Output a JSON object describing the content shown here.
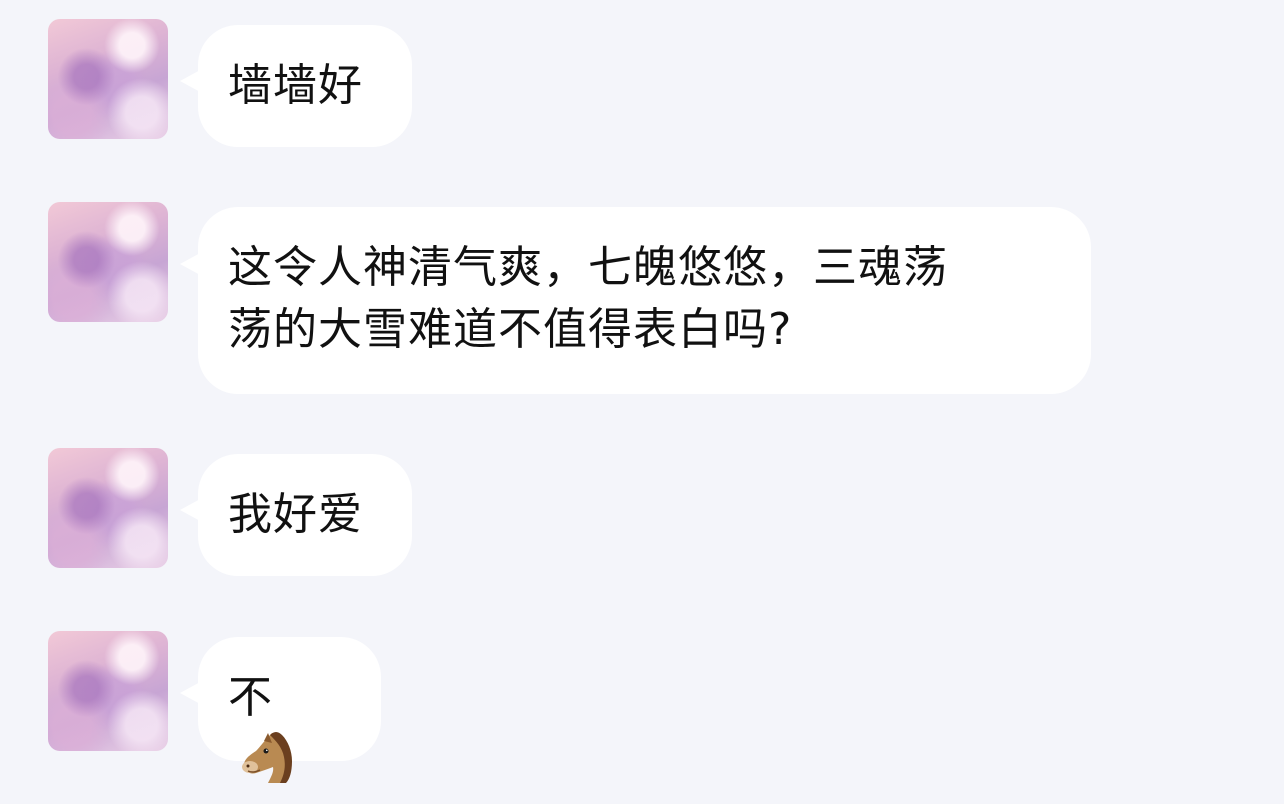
{
  "messages": [
    {
      "text": "墙墙好"
    },
    {
      "text": "这令人神清气爽，七魄悠悠，三魂荡\n荡的大雪难道不值得表白吗?"
    },
    {
      "text": "我好爱"
    },
    {
      "text": "不",
      "emoji": "horse-face"
    }
  ],
  "colors": {
    "background": "#f4f5fa",
    "bubble": "#ffffff",
    "text": "#111111"
  }
}
